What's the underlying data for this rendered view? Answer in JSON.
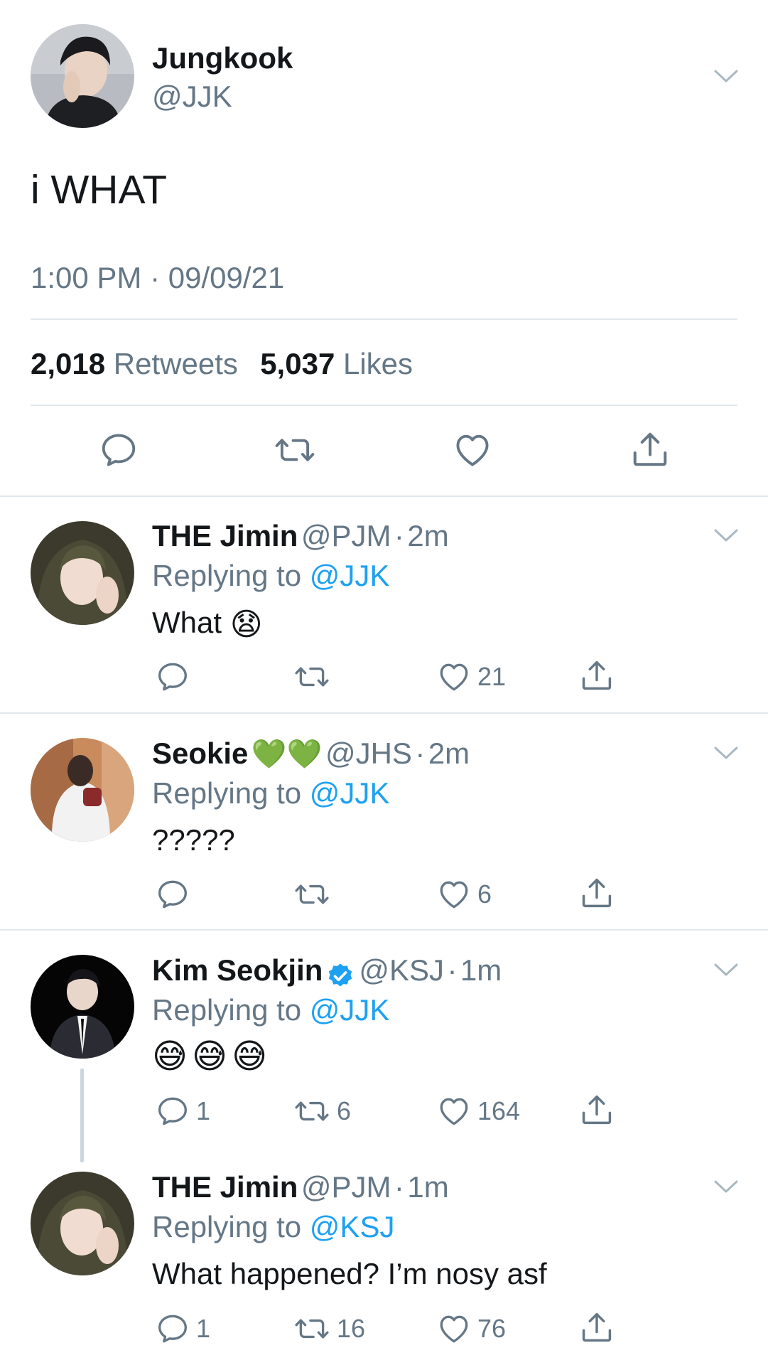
{
  "main_tweet": {
    "name": "Jungkook",
    "handle": "@JJK",
    "text": "i WHAT",
    "timestamp": "1:00 PM · 09/09/21",
    "retweets_count": "2,018",
    "retweets_label": "Retweets",
    "likes_count": "5,037",
    "likes_label": "Likes"
  },
  "replies": [
    {
      "name": "THE Jimin",
      "handle": "@PJM",
      "sep": "·",
      "time": "2m",
      "replying_prefix": "Replying to",
      "replying_to": "@JJK",
      "text": "What",
      "emoji": "😧",
      "reply_count": "",
      "retweet_count": "",
      "like_count": "21"
    },
    {
      "name": "Seokie",
      "name_emoji": "💚💚",
      "handle": "@JHS",
      "sep": "·",
      "time": "2m",
      "replying_prefix": "Replying to",
      "replying_to": "@JJK",
      "text": "?????",
      "reply_count": "",
      "retweet_count": "",
      "like_count": "6"
    },
    {
      "name": "Kim Seokjin",
      "verified": true,
      "handle": "@KSJ",
      "sep": "·",
      "time": "1m",
      "replying_prefix": "Replying to",
      "replying_to": "@JJK",
      "emoji": "😅😅😅",
      "reply_count": "1",
      "retweet_count": "6",
      "like_count": "164"
    },
    {
      "name": "THE Jimin",
      "handle": "@PJM",
      "sep": "·",
      "time": "1m",
      "replying_prefix": "Replying to",
      "replying_to": "@KSJ",
      "text": "What happened? I’m nosy asf",
      "reply_count": "1",
      "retweet_count": "16",
      "like_count": "76"
    }
  ],
  "colors": {
    "link": "#1da1f2",
    "secondary_text": "#657786",
    "divider": "#e1e8ed",
    "heart_green": "#3fc13f"
  },
  "icons": [
    "reply-icon",
    "retweet-icon",
    "like-icon",
    "share-icon",
    "chevron-down-icon",
    "verified-badge-icon"
  ]
}
